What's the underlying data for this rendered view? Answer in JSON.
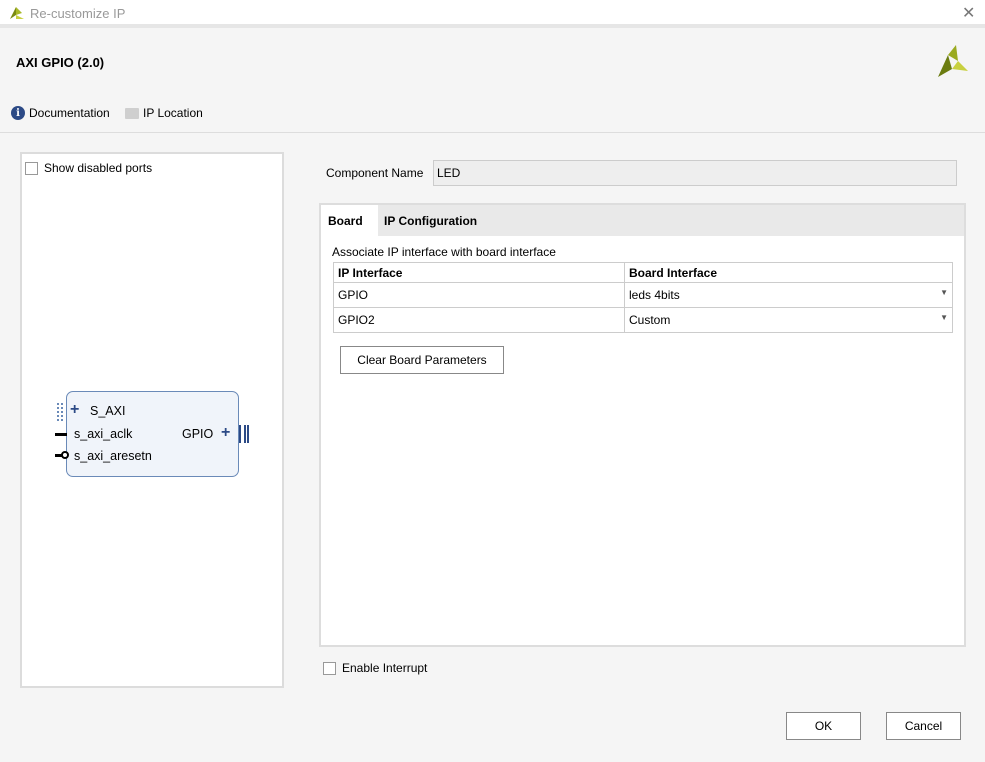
{
  "window": {
    "title": "Re-customize IP",
    "close": "✕"
  },
  "header": {
    "ip_name": "AXI GPIO (2.0)",
    "documentation": "Documentation",
    "ip_location": "IP Location",
    "info_glyph": "i"
  },
  "left": {
    "show_disabled_ports": "Show disabled ports",
    "block": {
      "s_axi": "S_AXI",
      "aclk": "s_axi_aclk",
      "aresetn": "s_axi_aresetn",
      "gpio": "GPIO"
    }
  },
  "component": {
    "label": "Component Name",
    "value": "LED"
  },
  "tabs": [
    {
      "label": "Board",
      "active": true
    },
    {
      "label": "IP Configuration",
      "active": false
    }
  ],
  "board": {
    "description": "Associate IP interface with board interface",
    "headers": [
      "IP Interface",
      "Board Interface"
    ],
    "rows": [
      {
        "ip": "GPIO",
        "board": "leds 4bits"
      },
      {
        "ip": "GPIO2",
        "board": "Custom"
      }
    ],
    "clear_button": "Clear Board Parameters"
  },
  "enable_interrupt": {
    "label": "Enable Interrupt",
    "checked": false
  },
  "footer": {
    "ok": "OK",
    "cancel": "Cancel"
  },
  "colors": {
    "accent": "#2c4a86",
    "logo": "#8a9a1a"
  }
}
